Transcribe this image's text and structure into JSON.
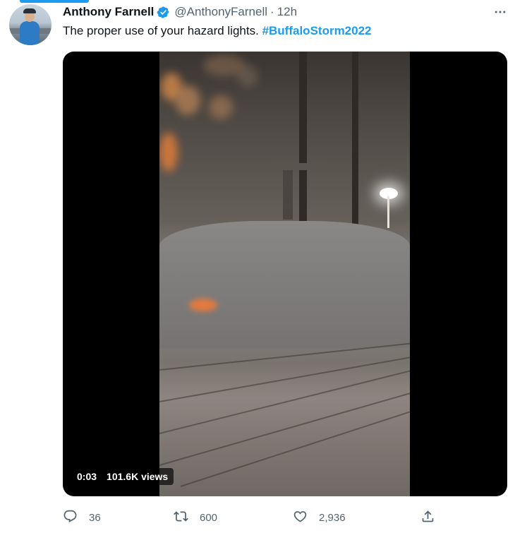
{
  "author": {
    "display_name": "Anthony Farnell",
    "handle": "@AnthonyFarnell",
    "separator": "·",
    "time_ago": "12h",
    "verified": true
  },
  "tweet": {
    "text": "The proper use of your hazard lights.",
    "hashtag": "#BuffaloStorm2022"
  },
  "video": {
    "duration": "0:03",
    "views": "101.6K views"
  },
  "actions": {
    "replies": "36",
    "retweets": "600",
    "likes": "2,936"
  },
  "icons": {
    "more": "more-icon",
    "verified": "verified-badge-icon",
    "reply": "reply-icon",
    "retweet": "retweet-icon",
    "like": "like-icon",
    "share": "share-icon"
  },
  "colors": {
    "accent": "#1d9bf0",
    "secondary_text": "#536471",
    "primary_text": "#0f1419"
  }
}
